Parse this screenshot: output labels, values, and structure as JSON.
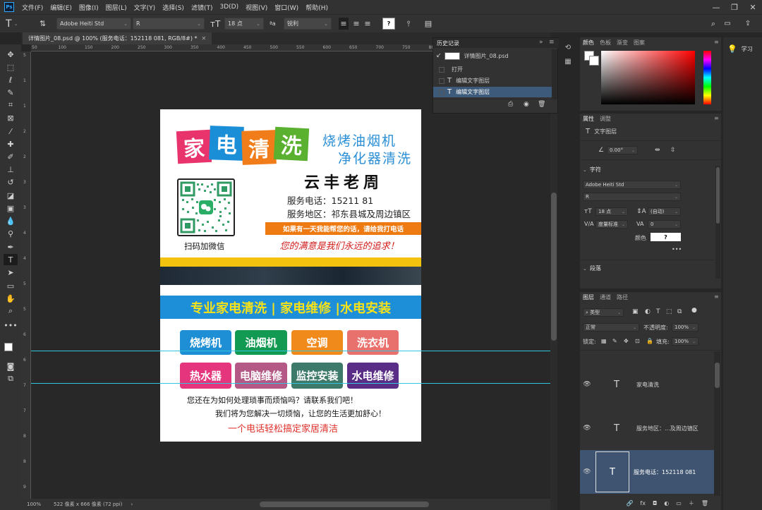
{
  "menubar": {
    "logo": "Ps",
    "items": [
      "文件(F)",
      "编辑(E)",
      "图像(I)",
      "图层(L)",
      "文字(Y)",
      "选择(S)",
      "滤镜(T)",
      "3D(D)",
      "视图(V)",
      "窗口(W)",
      "帮助(H)"
    ],
    "minimize": "—",
    "restore": "❐",
    "close": "✕"
  },
  "options_bar": {
    "tool_glyph": "T",
    "font_family": "Adobe Heiti Std",
    "font_style": "R",
    "font_size": "18 点",
    "aa_label": "ªa",
    "antialias": "锐利",
    "color_swatch_text": "?"
  },
  "document_tab": {
    "title": "详情图片_08.psd @ 100% (服务电话：152118  081, RGB/8#) *",
    "close": "✕"
  },
  "ruler_h_ticks": [
    "50",
    "100",
    "150",
    "200",
    "250",
    "300",
    "350",
    "400",
    "450",
    "500",
    "550",
    "600",
    "650",
    "700",
    "750",
    "800",
    "850",
    "900",
    "950"
  ],
  "ruler_v_ticks": [
    "5",
    "1",
    "1",
    "2",
    "2",
    "3",
    "3",
    "4",
    "4",
    "5",
    "5",
    "6",
    "6",
    "7",
    "7",
    "8",
    "8",
    "9"
  ],
  "status_bar": {
    "zoom": "100%",
    "doc_info": "522 像素 x 666 像素 (72 ppi)",
    "arrow": "›"
  },
  "artwork": {
    "logo_chars": [
      "家",
      "电",
      "清",
      "洗"
    ],
    "logo_colors": [
      "#e8336d",
      "#1a8fd8",
      "#f07d1a",
      "#5ab02f"
    ],
    "slogan_line1": "烧烤油烟机",
    "slogan_line2": "净化器清洗",
    "owner": "云丰老周",
    "phone": "服务电话：15211    81",
    "area": "服务地区：祁东县城及周边镇区",
    "banner": "如果有一天我能帮您的话，请给我打电话",
    "motto": "您的满意是我们永远的追求！",
    "qr_caption": "扫码加微信",
    "services_bar": "专业家电清洗 | 家电维修 |水电安装",
    "buttons_row1": [
      {
        "label": "烧烤机",
        "color": "#1e8fd5"
      },
      {
        "label": "油烟机",
        "color": "#139a52"
      },
      {
        "label": "空调",
        "color": "#ef8a1b"
      },
      {
        "label": "洗衣机",
        "color": "#e9716d"
      }
    ],
    "buttons_row2": [
      {
        "label": "热水器",
        "color": "#e5357d"
      },
      {
        "label": "电脑维修",
        "color": "#b45885"
      },
      {
        "label": "监控安装",
        "color": "#3e7a6a"
      },
      {
        "label": "水电维修",
        "color": "#5a2d86"
      }
    ],
    "bottom_line1": "您还在为如何处理琐事而烦恼吗？请联系我们吧！",
    "bottom_line2": "我们将为您解决一切烦恼，让您的生活更加舒心！",
    "bottom_line3": "一个电话轻松搞定家居清洁"
  },
  "history_panel": {
    "title": "历史记录",
    "collapse": "»",
    "menu": "≡",
    "snapshot": "详情图片_08.psd",
    "items": [
      "打开",
      "编辑文字图层",
      "编辑文字图层"
    ]
  },
  "color_panel": {
    "tabs": [
      "颜色",
      "色板",
      "渐变",
      "图案"
    ]
  },
  "properties_panel": {
    "tabs": [
      "属性",
      "调整"
    ],
    "layer_type": "文字图层",
    "angle": "0.00°",
    "char_section": "字符",
    "font_family": "Adobe Heiti Std",
    "font_style": "R",
    "font_size": "18 点",
    "leading": "(自动)",
    "kerning": "度量标准",
    "tracking": "0",
    "color_label": "颜色",
    "color_value": "?",
    "more": "•••",
    "para_section": "段落"
  },
  "learn_panel": {
    "label": "学习"
  },
  "layers_panel": {
    "tabs": [
      "图层",
      "通道",
      "路径"
    ],
    "filter_kind": "类型",
    "blend_mode": "正常",
    "opacity_label": "不透明度:",
    "opacity": "100%",
    "lock_label": "锁定:",
    "fill_label": "填充:",
    "fill": "100%",
    "layers": [
      {
        "name": "家电清洗",
        "selected": false
      },
      {
        "name": "服务地区：...及周边镇区",
        "selected": false
      },
      {
        "name": "服务电话：152118  081",
        "selected": true
      }
    ],
    "footer_icons": [
      "🔗",
      "fx",
      "◘",
      "◐",
      "▭",
      "＋",
      "🗑"
    ]
  }
}
